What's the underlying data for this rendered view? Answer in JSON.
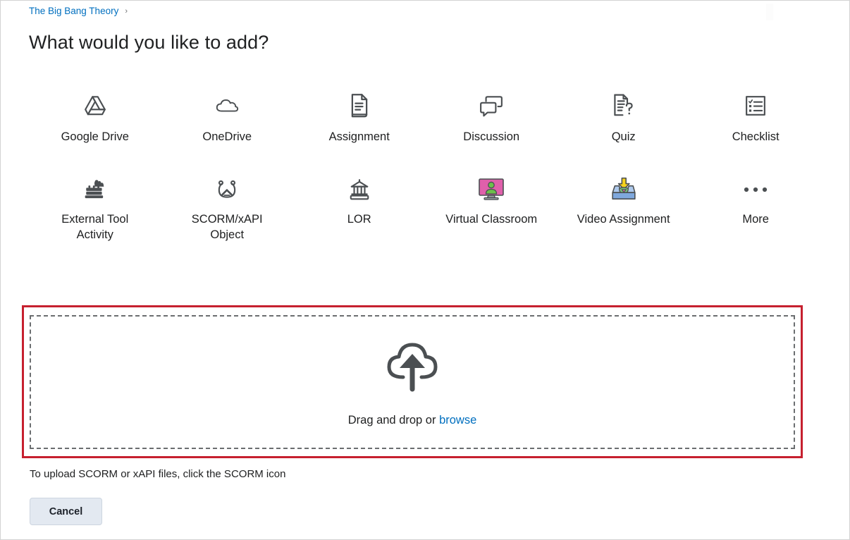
{
  "breadcrumb": {
    "link_label": "The Big Bang Theory",
    "separator": "›"
  },
  "header": {
    "title": "What would you like to add?"
  },
  "tiles_row_1": [
    {
      "label": "Google Drive",
      "icon": "google-drive-icon"
    },
    {
      "label": "OneDrive",
      "icon": "onedrive-cloud-icon"
    },
    {
      "label": "Assignment",
      "icon": "assignment-document-icon"
    },
    {
      "label": "Discussion",
      "icon": "discussion-speech-bubbles-icon"
    },
    {
      "label": "Quiz",
      "icon": "quiz-question-document-icon"
    },
    {
      "label": "Checklist",
      "icon": "checklist-icon"
    }
  ],
  "tiles_row_2": [
    {
      "label": "External Tool Activity",
      "icon": "external-tool-blocks-icon"
    },
    {
      "label": "SCORM/xAPI Object",
      "icon": "scorm-xapi-icon"
    },
    {
      "label": "LOR",
      "icon": "lor-bank-icon"
    },
    {
      "label": "Virtual Classroom",
      "icon": "virtual-classroom-monitor-icon"
    },
    {
      "label": "Video Assignment",
      "icon": "video-assignment-tray-icon"
    },
    {
      "label": "More",
      "icon": "more-ellipsis-icon"
    }
  ],
  "dropzone": {
    "icon": "cloud-upload-icon",
    "text_prefix": "Drag and drop or ",
    "browse_label": "browse"
  },
  "hint": {
    "text": "To upload SCORM or xAPI files, click the SCORM icon"
  },
  "footer": {
    "cancel_label": "Cancel"
  },
  "colors": {
    "link": "#006fbf",
    "highlight_border": "#c6202f",
    "icon_stroke": "#4b4f52",
    "virtual_classroom_screen": "#e060ab",
    "virtual_classroom_person": "#6cc04a",
    "video_assignment_tray": "#7fa8dd",
    "video_assignment_arrow": "#f5d21e",
    "cancel_background": "#e3e9f1"
  }
}
